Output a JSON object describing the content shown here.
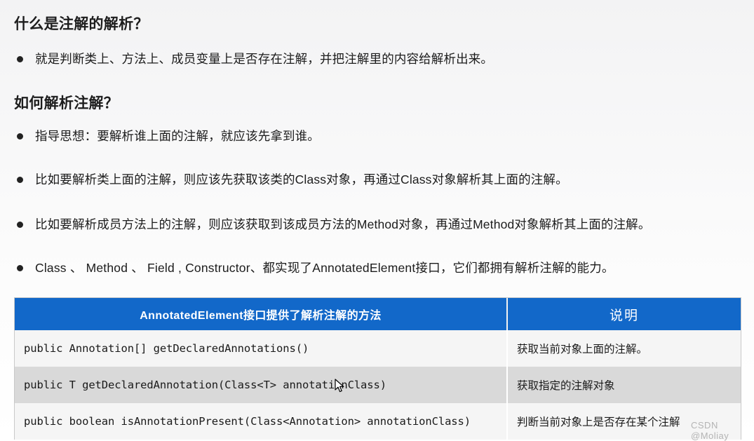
{
  "document": {
    "headings": [
      {
        "id": "h1",
        "text": "什么是注解的解析？"
      },
      {
        "id": "h2",
        "text": "如何解析注解？"
      }
    ],
    "bullets": [
      {
        "id": "b0",
        "text": "就是判断类上、方法上、成员变量上是否存在注解，并把注解里的内容给解析出来。"
      },
      {
        "id": "b1",
        "text": "指导思想：要解析谁上面的注解，就应该先拿到谁。"
      },
      {
        "id": "b2",
        "text": "比如要解析类上面的注解，则应该先获取该类的Class对象，再通过Class对象解析其上面的注解。"
      },
      {
        "id": "b3",
        "text": "比如要解析成员方法上的注解，则应该获取到该成员方法的Method对象，再通过Method对象解析其上面的注解。"
      },
      {
        "id": "b4",
        "text": "Class 、 Method 、 Field , Constructor、都实现了AnnotatedElement接口，它们都拥有解析注解的能力。"
      }
    ]
  },
  "table": {
    "headers": [
      "AnnotatedElement接口提供了解析注解的方法",
      "说明"
    ],
    "rows": [
      {
        "method": "public Annotation[] getDeclaredAnnotations()",
        "description": "获取当前对象上面的注解。"
      },
      {
        "method": "public T getDeclaredAnnotation(Class<T> annotationClass)",
        "description": "获取指定的注解对象"
      },
      {
        "method": "public boolean isAnnotationPresent(Class<Annotation> annotationClass)",
        "description": "判断当前对象上是否存在某个注解"
      }
    ]
  },
  "watermark": {
    "text": "CSDN @Moliay"
  },
  "colors": {
    "table_header_bg": "#1268c9",
    "table_header_fg": "#ffffff",
    "row_light_bg": "#f5f5f5",
    "row_dark_bg": "#d9d9d9",
    "text": "#1a1a1a",
    "bullet": "#222222",
    "watermark": "#b4b4b4"
  }
}
